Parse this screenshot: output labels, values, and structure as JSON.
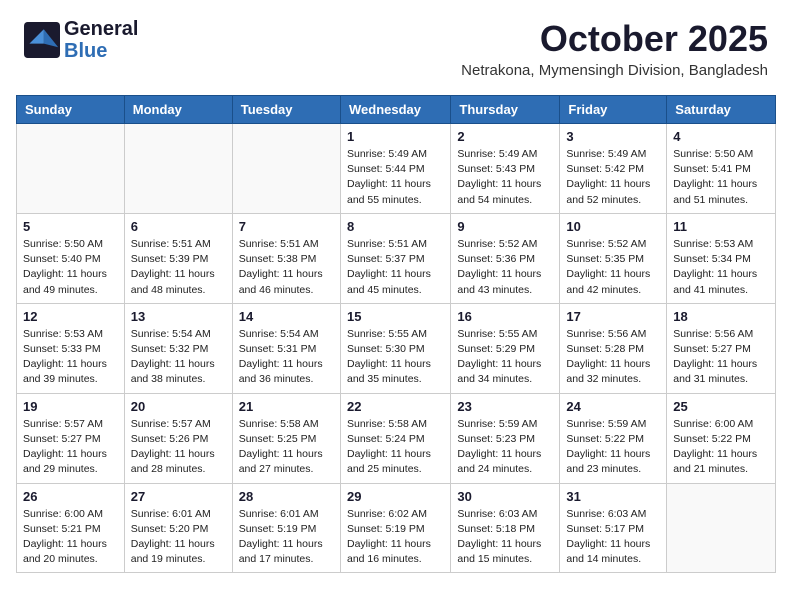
{
  "logo": {
    "line1": "General",
    "line2": "Blue"
  },
  "title": "October 2025",
  "subtitle": "Netrakona, Mymensingh Division, Bangladesh",
  "headers": [
    "Sunday",
    "Monday",
    "Tuesday",
    "Wednesday",
    "Thursday",
    "Friday",
    "Saturday"
  ],
  "weeks": [
    [
      {
        "day": "",
        "info": ""
      },
      {
        "day": "",
        "info": ""
      },
      {
        "day": "",
        "info": ""
      },
      {
        "day": "1",
        "info": "Sunrise: 5:49 AM\nSunset: 5:44 PM\nDaylight: 11 hours\nand 55 minutes."
      },
      {
        "day": "2",
        "info": "Sunrise: 5:49 AM\nSunset: 5:43 PM\nDaylight: 11 hours\nand 54 minutes."
      },
      {
        "day": "3",
        "info": "Sunrise: 5:49 AM\nSunset: 5:42 PM\nDaylight: 11 hours\nand 52 minutes."
      },
      {
        "day": "4",
        "info": "Sunrise: 5:50 AM\nSunset: 5:41 PM\nDaylight: 11 hours\nand 51 minutes."
      }
    ],
    [
      {
        "day": "5",
        "info": "Sunrise: 5:50 AM\nSunset: 5:40 PM\nDaylight: 11 hours\nand 49 minutes."
      },
      {
        "day": "6",
        "info": "Sunrise: 5:51 AM\nSunset: 5:39 PM\nDaylight: 11 hours\nand 48 minutes."
      },
      {
        "day": "7",
        "info": "Sunrise: 5:51 AM\nSunset: 5:38 PM\nDaylight: 11 hours\nand 46 minutes."
      },
      {
        "day": "8",
        "info": "Sunrise: 5:51 AM\nSunset: 5:37 PM\nDaylight: 11 hours\nand 45 minutes."
      },
      {
        "day": "9",
        "info": "Sunrise: 5:52 AM\nSunset: 5:36 PM\nDaylight: 11 hours\nand 43 minutes."
      },
      {
        "day": "10",
        "info": "Sunrise: 5:52 AM\nSunset: 5:35 PM\nDaylight: 11 hours\nand 42 minutes."
      },
      {
        "day": "11",
        "info": "Sunrise: 5:53 AM\nSunset: 5:34 PM\nDaylight: 11 hours\nand 41 minutes."
      }
    ],
    [
      {
        "day": "12",
        "info": "Sunrise: 5:53 AM\nSunset: 5:33 PM\nDaylight: 11 hours\nand 39 minutes."
      },
      {
        "day": "13",
        "info": "Sunrise: 5:54 AM\nSunset: 5:32 PM\nDaylight: 11 hours\nand 38 minutes."
      },
      {
        "day": "14",
        "info": "Sunrise: 5:54 AM\nSunset: 5:31 PM\nDaylight: 11 hours\nand 36 minutes."
      },
      {
        "day": "15",
        "info": "Sunrise: 5:55 AM\nSunset: 5:30 PM\nDaylight: 11 hours\nand 35 minutes."
      },
      {
        "day": "16",
        "info": "Sunrise: 5:55 AM\nSunset: 5:29 PM\nDaylight: 11 hours\nand 34 minutes."
      },
      {
        "day": "17",
        "info": "Sunrise: 5:56 AM\nSunset: 5:28 PM\nDaylight: 11 hours\nand 32 minutes."
      },
      {
        "day": "18",
        "info": "Sunrise: 5:56 AM\nSunset: 5:27 PM\nDaylight: 11 hours\nand 31 minutes."
      }
    ],
    [
      {
        "day": "19",
        "info": "Sunrise: 5:57 AM\nSunset: 5:27 PM\nDaylight: 11 hours\nand 29 minutes."
      },
      {
        "day": "20",
        "info": "Sunrise: 5:57 AM\nSunset: 5:26 PM\nDaylight: 11 hours\nand 28 minutes."
      },
      {
        "day": "21",
        "info": "Sunrise: 5:58 AM\nSunset: 5:25 PM\nDaylight: 11 hours\nand 27 minutes."
      },
      {
        "day": "22",
        "info": "Sunrise: 5:58 AM\nSunset: 5:24 PM\nDaylight: 11 hours\nand 25 minutes."
      },
      {
        "day": "23",
        "info": "Sunrise: 5:59 AM\nSunset: 5:23 PM\nDaylight: 11 hours\nand 24 minutes."
      },
      {
        "day": "24",
        "info": "Sunrise: 5:59 AM\nSunset: 5:22 PM\nDaylight: 11 hours\nand 23 minutes."
      },
      {
        "day": "25",
        "info": "Sunrise: 6:00 AM\nSunset: 5:22 PM\nDaylight: 11 hours\nand 21 minutes."
      }
    ],
    [
      {
        "day": "26",
        "info": "Sunrise: 6:00 AM\nSunset: 5:21 PM\nDaylight: 11 hours\nand 20 minutes."
      },
      {
        "day": "27",
        "info": "Sunrise: 6:01 AM\nSunset: 5:20 PM\nDaylight: 11 hours\nand 19 minutes."
      },
      {
        "day": "28",
        "info": "Sunrise: 6:01 AM\nSunset: 5:19 PM\nDaylight: 11 hours\nand 17 minutes."
      },
      {
        "day": "29",
        "info": "Sunrise: 6:02 AM\nSunset: 5:19 PM\nDaylight: 11 hours\nand 16 minutes."
      },
      {
        "day": "30",
        "info": "Sunrise: 6:03 AM\nSunset: 5:18 PM\nDaylight: 11 hours\nand 15 minutes."
      },
      {
        "day": "31",
        "info": "Sunrise: 6:03 AM\nSunset: 5:17 PM\nDaylight: 11 hours\nand 14 minutes."
      },
      {
        "day": "",
        "info": ""
      }
    ]
  ]
}
